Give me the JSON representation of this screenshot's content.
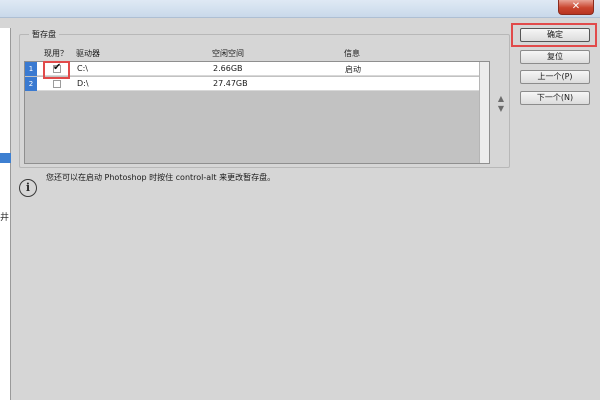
{
  "window": {
    "close_glyph": "✕"
  },
  "scratch_disks": {
    "group_title": "暂存盘",
    "columns": [
      "现用？",
      "驱动器",
      "空闲空间",
      "信息"
    ],
    "rows": [
      {
        "num": "1",
        "active": true,
        "drive": "C:\\",
        "free": "2.66GB",
        "info": "启动"
      },
      {
        "num": "2",
        "active": false,
        "drive": "D:\\",
        "free": "27.47GB",
        "info": ""
      }
    ],
    "order_arrows": {
      "up": "▲",
      "down": "▼"
    }
  },
  "info": {
    "icon": "info-icon",
    "text": "您还可以在启动 Photoshop 时按住 control-alt 来更改暂存盘。"
  },
  "buttons": {
    "ok": "确定",
    "reset": "复位",
    "prev": "上一个(P)",
    "next": "下一个(N)"
  },
  "left_panel": {
    "partial_char": "井"
  },
  "annotation_color": "#e14a4a"
}
